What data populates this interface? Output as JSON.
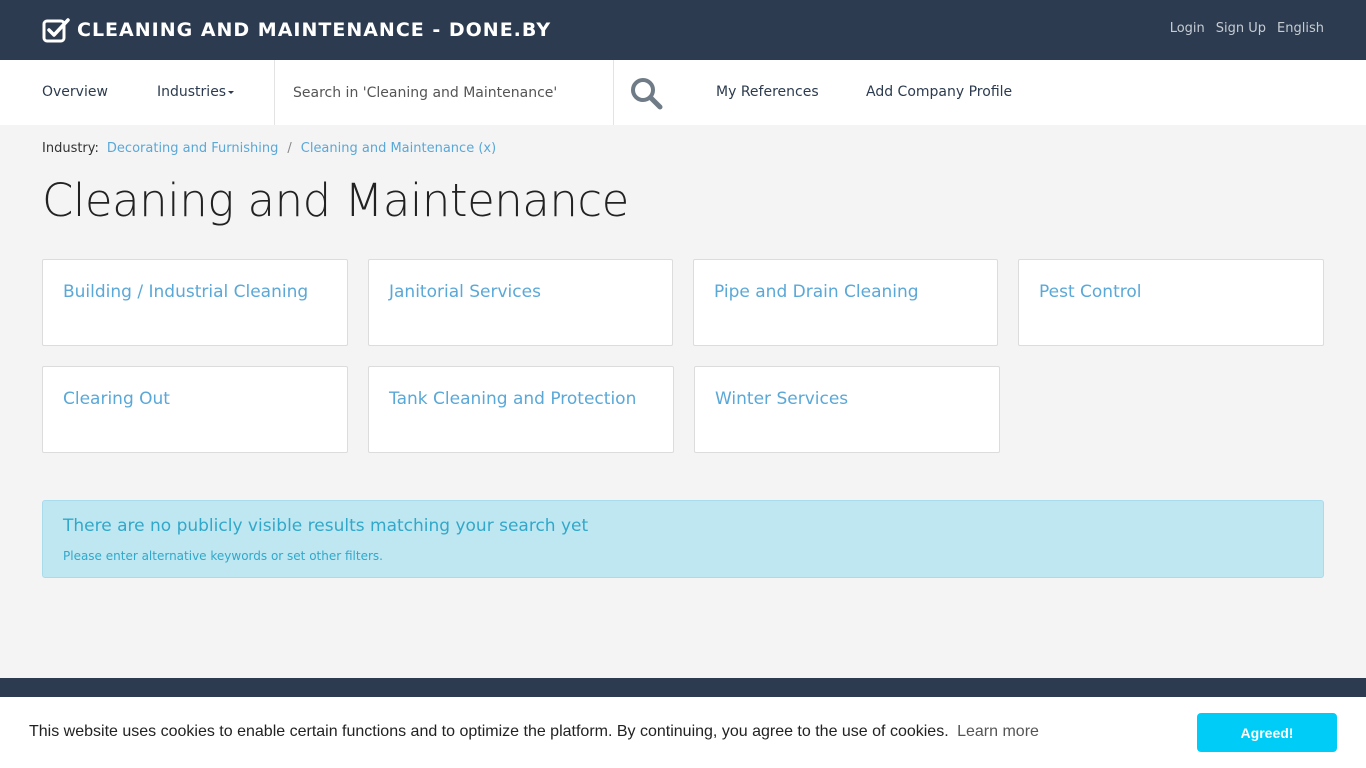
{
  "header": {
    "brand": "CLEANING AND MAINTENANCE - DONE.BY",
    "links": [
      "Login",
      "Sign Up",
      "English"
    ]
  },
  "nav": {
    "overview": "Overview",
    "industries": "Industries",
    "search_placeholder": "Search in 'Cleaning and Maintenance'",
    "my_references": "My References",
    "add_company_profile": "Add Company Profile"
  },
  "breadcrumb": {
    "label": "Industry:",
    "items": [
      "Decorating and Furnishing",
      "Cleaning and Maintenance (x)"
    ],
    "separator": "/"
  },
  "page": {
    "title": "Cleaning and Maintenance"
  },
  "categories": [
    "Building / Industrial Cleaning",
    "Janitorial Services",
    "Pipe and Drain Cleaning",
    "Pest Control",
    "Clearing Out",
    "Tank Cleaning and Protection",
    "Winter Services"
  ],
  "alert": {
    "title": "There are no publicly visible results matching your search yet",
    "subtitle": "Please enter alternative keywords or set other filters."
  },
  "cookie": {
    "text": "This website uses cookies to enable certain functions and to optimize the platform. By continuing, you agree to the use of cookies.",
    "link": "Learn more",
    "button": "Agreed!"
  },
  "colors": {
    "topbar": "#2c3b4f",
    "link": "#5aa8d8",
    "alert_bg": "#bfe7f2",
    "alert_text": "#31a8c9",
    "cookie_button": "#00cdf7"
  }
}
